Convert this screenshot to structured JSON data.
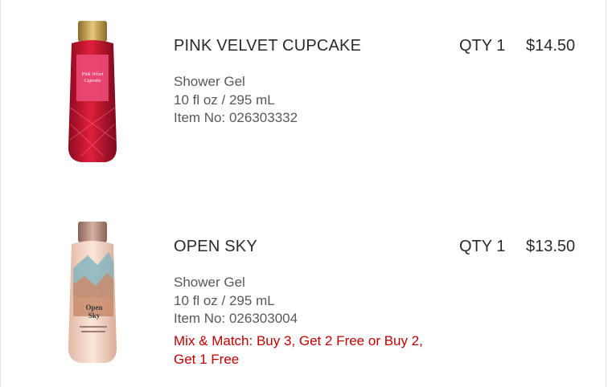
{
  "items": [
    {
      "name": "PINK VELVET CUPCAKE",
      "qty": "QTY 1",
      "price": "$14.50",
      "type": "Shower Gel",
      "size": "10 fl oz / 295 mL",
      "item_no": "Item No: 026303332",
      "thumb_label": "Pink Velvet Cupcake",
      "colors": {
        "bottle": "#c8102e",
        "cap": "#c9a24a",
        "label": "#e8356b"
      }
    },
    {
      "name": "OPEN SKY",
      "qty": "QTY 1",
      "price": "$13.50",
      "type": "Shower Gel",
      "size": "10 fl oz / 295 mL",
      "item_no": "Item No: 026303004",
      "promo": "Mix & Match: Buy 3, Get 2 Free or Buy 2, Get 1 Free",
      "thumb_label": "Open Sky",
      "colors": {
        "bottle": "#f3d6c6",
        "cap": "#b98a7a",
        "label": "#e9b7a1"
      }
    }
  ]
}
